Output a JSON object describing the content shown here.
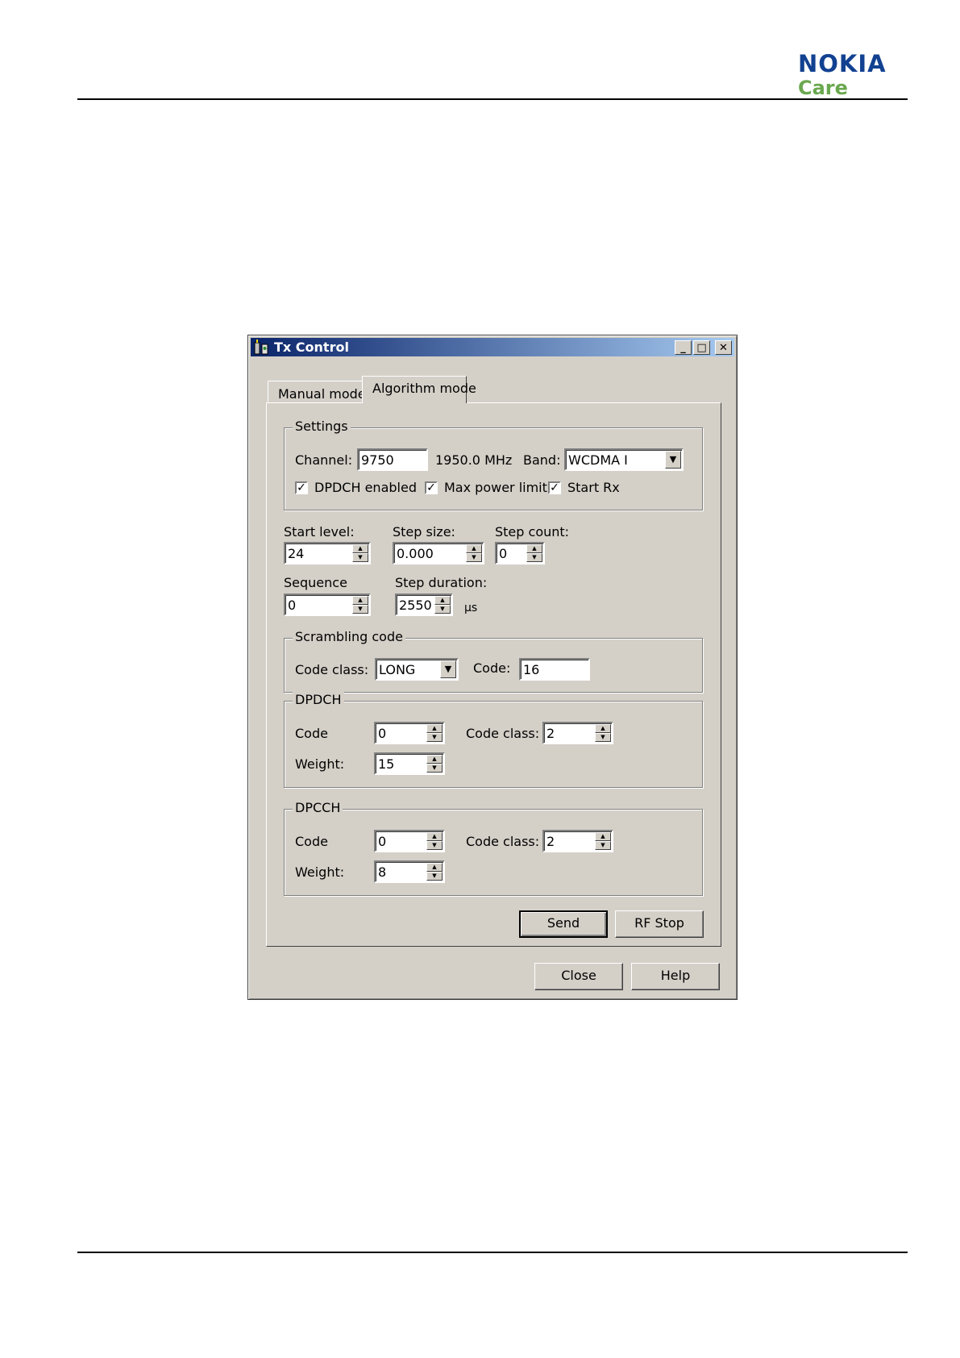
{
  "brand": {
    "name": "NOKIA",
    "sub": "Care",
    "color_primary": "#124191",
    "color_secondary": "#6aa84f"
  },
  "window": {
    "title": "Tx Control",
    "icons": {
      "app": "antenna-app-icon",
      "minimize": "minimize-icon",
      "maximize": "maximize-icon",
      "close": "close-icon"
    },
    "tabs": [
      {
        "label": "Manual mode"
      },
      {
        "label": "Algorithm mode"
      }
    ],
    "settings": {
      "legend": "Settings",
      "channel_label": "Channel:",
      "channel_value": "9750",
      "freq": "1950.0 MHz",
      "band_label": "Band:",
      "band_value": "WCDMA I",
      "dpdch_enabled": "DPDCH enabled",
      "max_power": "Max power limit",
      "start_rx": "Start Rx"
    },
    "params": {
      "start_level_label": "Start level:",
      "start_level_value": "24",
      "step_size_label": "Step size:",
      "step_size_value": "0.000",
      "step_count_label": "Step count:",
      "step_count_value": "0",
      "sequence_label": "Sequence",
      "sequence_value": "0",
      "step_duration_label": "Step duration:",
      "step_duration_value": "2550",
      "unit": "µs"
    },
    "scrambling": {
      "legend": "Scrambling code",
      "code_class_label": "Code class:",
      "code_class_value": "LONG",
      "code_label": "Code:",
      "code_value": "16"
    },
    "dpdch": {
      "legend": "DPDCH",
      "code_label": "Code",
      "code_value": "0",
      "code_class_label": "Code class:",
      "code_class_value": "2",
      "weight_label": "Weight:",
      "weight_value": "15"
    },
    "dpcch": {
      "legend": "DPCCH",
      "code_label": "Code",
      "code_value": "0",
      "code_class_label": "Code class:",
      "code_class_value": "2",
      "weight_label": "Weight:",
      "weight_value": "8"
    },
    "buttons": {
      "send": "Send",
      "rf_stop": "RF Stop",
      "close": "Close",
      "help": "Help"
    }
  }
}
